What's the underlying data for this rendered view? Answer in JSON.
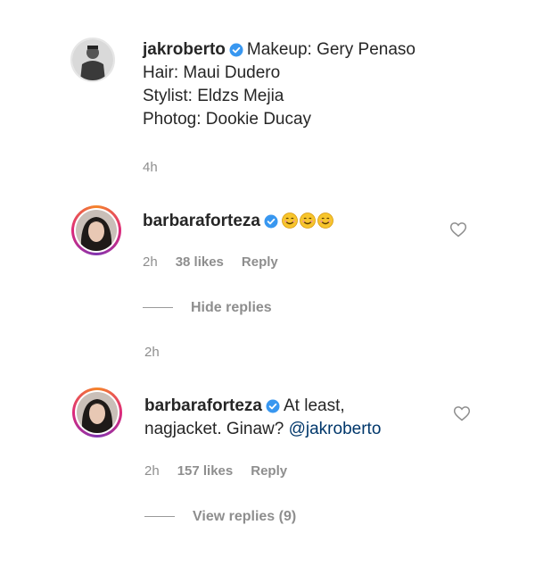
{
  "caption": {
    "username": "jakroberto",
    "lines": [
      "Makeup: Gery Penaso",
      "Hair: Maui Dudero",
      "Stylist: Eldzs Mejia",
      "Photog: Dookie Ducay"
    ],
    "time": "4h"
  },
  "comment1": {
    "username": "barbaraforteza",
    "emojis": [
      "smiling-face-icon",
      "smiling-face-icon",
      "smiling-face-icon"
    ],
    "time": "2h",
    "likes": "38 likes",
    "reply": "Reply",
    "toggle": "Hide replies"
  },
  "reply_time": "2h",
  "comment2": {
    "username": "barbaraforteza",
    "text_line1": "At least,",
    "text_line2": "nagjacket. Ginaw?",
    "mention": "@jakroberto",
    "time": "2h",
    "likes": "157 likes",
    "reply": "Reply",
    "toggle": "View replies (9)"
  },
  "colors": {
    "verified_blue": "#3897f0",
    "secondary_text": "#8e8e8e",
    "mention": "#00376b"
  }
}
